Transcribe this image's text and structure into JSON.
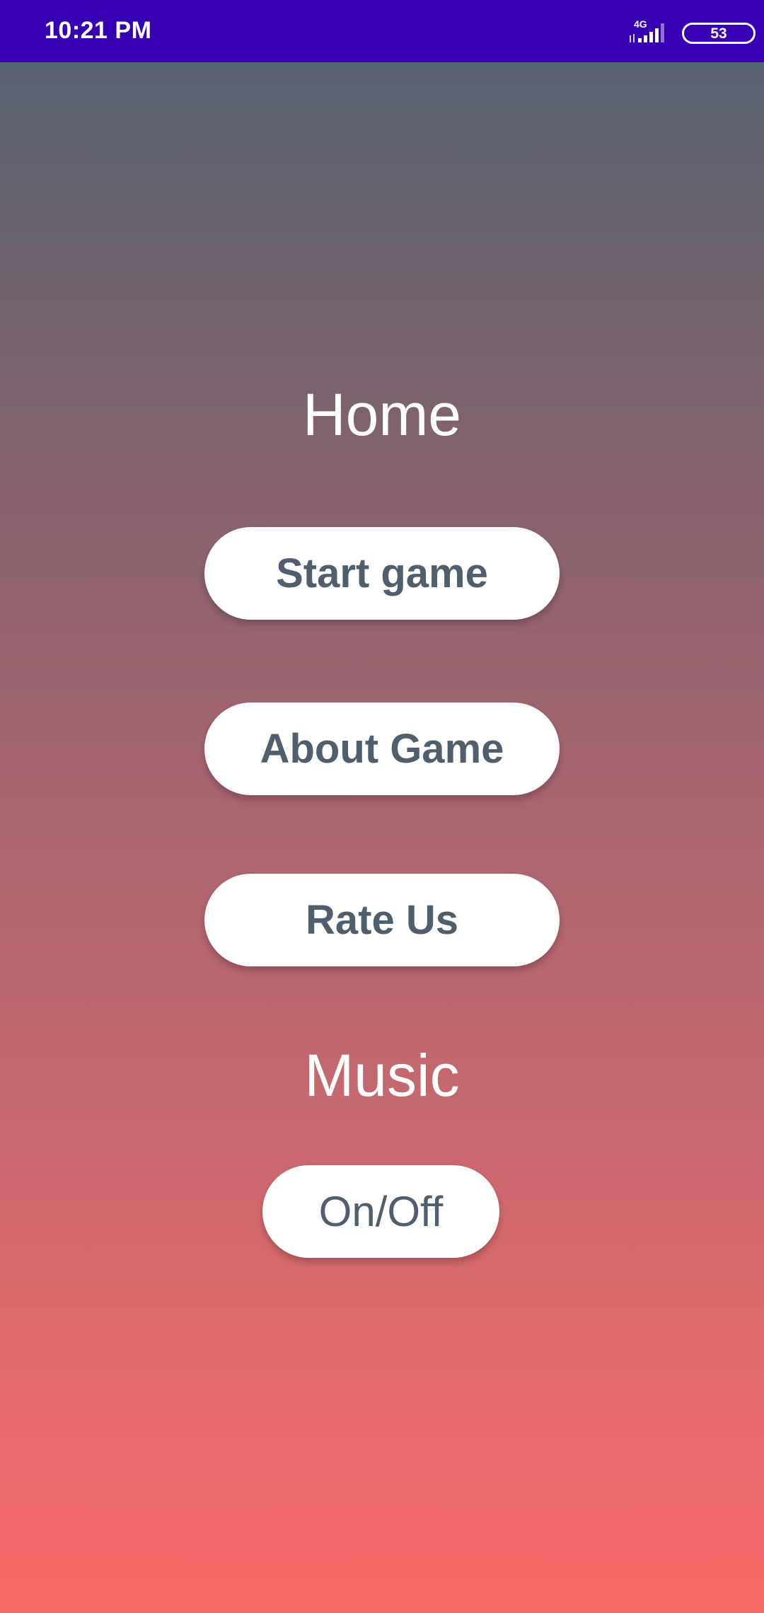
{
  "status_bar": {
    "time": "10:21 PM",
    "network_type": "4G",
    "battery_level": "53",
    "background_color": "#3700b3",
    "icons": [
      "signal-icon",
      "battery-icon"
    ]
  },
  "screen": {
    "gradient_top": "#586270",
    "gradient_bottom": "#fa6b69",
    "home_title": "Home",
    "buttons": {
      "start_game": "Start game",
      "about_game": "About Game",
      "rate_us": "Rate Us"
    },
    "music_title": "Music",
    "music_toggle": "On/Off",
    "button_text_color": "#4f5f6d"
  }
}
